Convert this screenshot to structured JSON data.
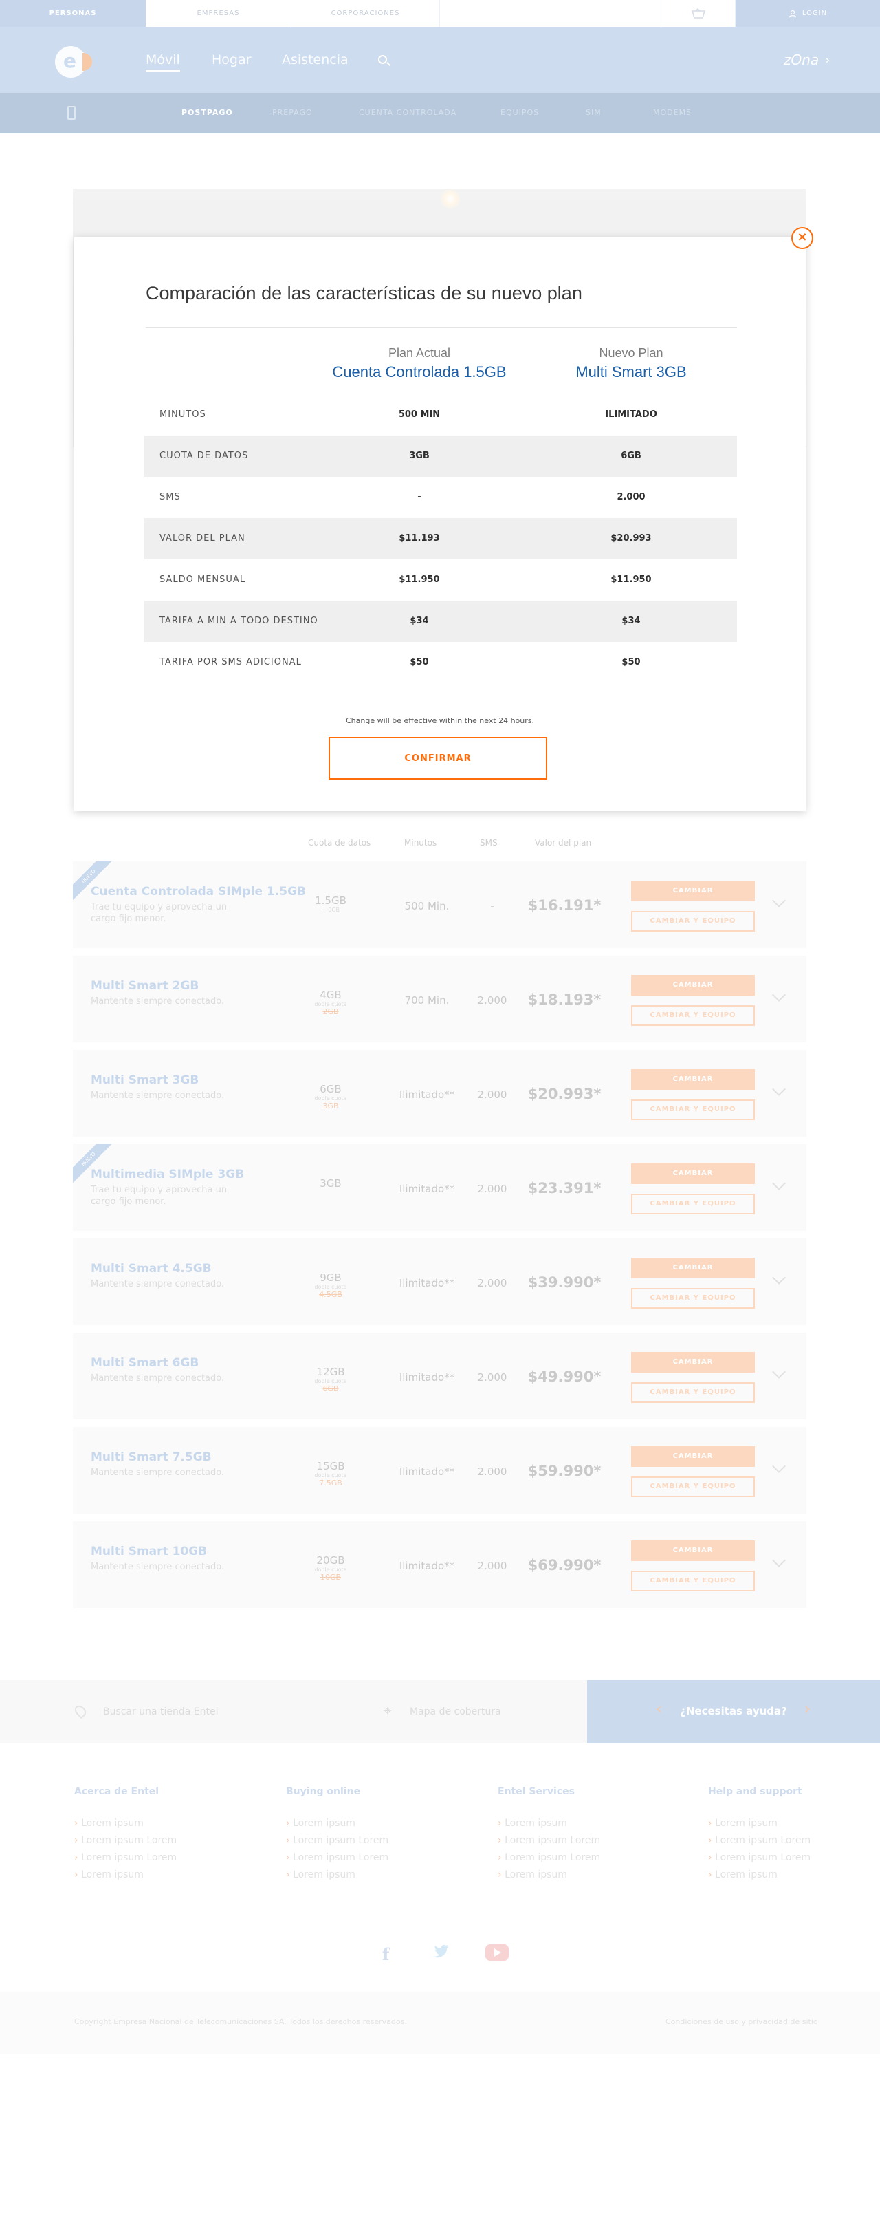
{
  "topbar": {
    "segments": [
      "PERSONAS",
      "EMPRESAS",
      "CORPORACIONES"
    ],
    "login": "LOGIN"
  },
  "nav": {
    "links": [
      "Móvil",
      "Hogar",
      "Asistencia"
    ],
    "zona": "zOna"
  },
  "subnav": {
    "items": [
      "POSTPAGO",
      "PREPAGO",
      "CUENTA CONTROLADA",
      "EQUIPOS",
      "SIM",
      "MODEMS"
    ]
  },
  "modal": {
    "title": "Comparación de las características de su nuevo plan",
    "current": {
      "caption": "Plan Actual",
      "name": "Cuenta Controlada 1.5GB"
    },
    "new": {
      "caption": "Nuevo Plan",
      "name": "Multi Smart 3GB"
    },
    "rows": [
      {
        "label": "MINUTOS",
        "current": "500 MIN",
        "new": "ILIMITADO"
      },
      {
        "label": "CUOTA DE DATOS",
        "current": "3GB",
        "new": "6GB"
      },
      {
        "label": "SMS",
        "current": "-",
        "new": "2.000"
      },
      {
        "label": "VALOR DEL PLAN",
        "current": "$11.193",
        "new": "$20.993"
      },
      {
        "label": "SALDO MENSUAL",
        "current": "$11.950",
        "new": "$11.950"
      },
      {
        "label": "TARIFA A MIN A TODO DESTINO",
        "current": "$34",
        "new": "$34"
      },
      {
        "label": "TARIFA POR SMS ADICIONAL",
        "current": "$50",
        "new": "$50"
      }
    ],
    "note": "Change will be effective within the next 24 hours.",
    "confirm": "CONFIRMAR"
  },
  "plans_header": {
    "data": "Cuota de datos",
    "minutes": "Minutos",
    "sms": "SMS",
    "value": "Valor del plan"
  },
  "plans": [
    {
      "name": "Cuenta Controlada SIMple 1.5GB",
      "desc": "Trae tu equipo y aprovecha un cargo fijo menor.",
      "data": "1.5GB",
      "data_extra": "+ 0GB",
      "data_old": "",
      "minutes": "500 Min.",
      "sms": "-",
      "value": "$16.191*",
      "ribbon": "NUEVO"
    },
    {
      "name": "Multi Smart 2GB",
      "desc": "Mantente siempre conectado.",
      "data": "4GB",
      "data_extra": "doble cuota",
      "data_old": "2GB",
      "minutes": "700 Min.",
      "sms": "2.000",
      "value": "$18.193*",
      "ribbon": ""
    },
    {
      "name": "Multi Smart 3GB",
      "desc": "Mantente siempre conectado.",
      "data": "6GB",
      "data_extra": "doble cuota",
      "data_old": "3GB",
      "minutes": "Ilimitado**",
      "sms": "2.000",
      "value": "$20.993*",
      "ribbon": ""
    },
    {
      "name": "Multimedia SIMple 3GB",
      "desc": "Trae tu equipo y aprovecha un cargo fijo menor.",
      "data": "3GB",
      "data_extra": "",
      "data_old": "",
      "minutes": "Ilimitado**",
      "sms": "2.000",
      "value": "$23.391*",
      "ribbon": "NUEVO"
    },
    {
      "name": "Multi Smart 4.5GB",
      "desc": "Mantente siempre conectado.",
      "data": "9GB",
      "data_extra": "doble cuota",
      "data_old": "4.5GB",
      "minutes": "Ilimitado**",
      "sms": "2.000",
      "value": "$39.990*",
      "ribbon": ""
    },
    {
      "name": "Multi Smart 6GB",
      "desc": "Mantente siempre conectado.",
      "data": "12GB",
      "data_extra": "doble cuota",
      "data_old": "6GB",
      "minutes": "Ilimitado**",
      "sms": "2.000",
      "value": "$49.990*",
      "ribbon": ""
    },
    {
      "name": "Multi Smart 7.5GB",
      "desc": "Mantente siempre conectado.",
      "data": "15GB",
      "data_extra": "doble cuota",
      "data_old": "7.5GB",
      "minutes": "Ilimitado**",
      "sms": "2.000",
      "value": "$59.990*",
      "ribbon": ""
    },
    {
      "name": "Multi Smart 10GB",
      "desc": "Mantente siempre conectado.",
      "data": "20GB",
      "data_extra": "doble cuota",
      "data_old": "10GB",
      "minutes": "Ilimitado**",
      "sms": "2.000",
      "value": "$69.990*",
      "ribbon": ""
    }
  ],
  "plan_buttons": {
    "change": "CAMBIAR",
    "change_device": "CAMBIAR Y EQUIPO"
  },
  "strip": {
    "store_search": "Buscar una tienda Entel",
    "coverage": "Mapa de cobertura",
    "help": "¿Necesitas ayuda?"
  },
  "footer": {
    "columns": [
      {
        "title": "Acerca de Entel",
        "links": [
          "Lorem ipsum",
          "Lorem ipsum Lorem",
          "Lorem ipsum Lorem",
          "Lorem ipsum"
        ]
      },
      {
        "title": "Buying online",
        "links": [
          "Lorem ipsum",
          "Lorem ipsum Lorem",
          "Lorem ipsum Lorem",
          "Lorem ipsum"
        ]
      },
      {
        "title": "Entel Services",
        "links": [
          "Lorem ipsum",
          "Lorem ipsum Lorem",
          "Lorem ipsum Lorem",
          "Lorem ipsum"
        ]
      },
      {
        "title": "Help and support",
        "links": [
          "Lorem ipsum",
          "Lorem ipsum Lorem",
          "Lorem ipsum Lorem",
          "Lorem ipsum"
        ]
      }
    ],
    "copyright": "Copyright Empresa Nacional de Telecomunicaciones SA. Todos los derechos reservados.",
    "terms": "Condiciones de uso y privacidad de sitio"
  },
  "colors": {
    "accent": "#ff6d0a",
    "brand_blue": "#1b5fa8"
  }
}
